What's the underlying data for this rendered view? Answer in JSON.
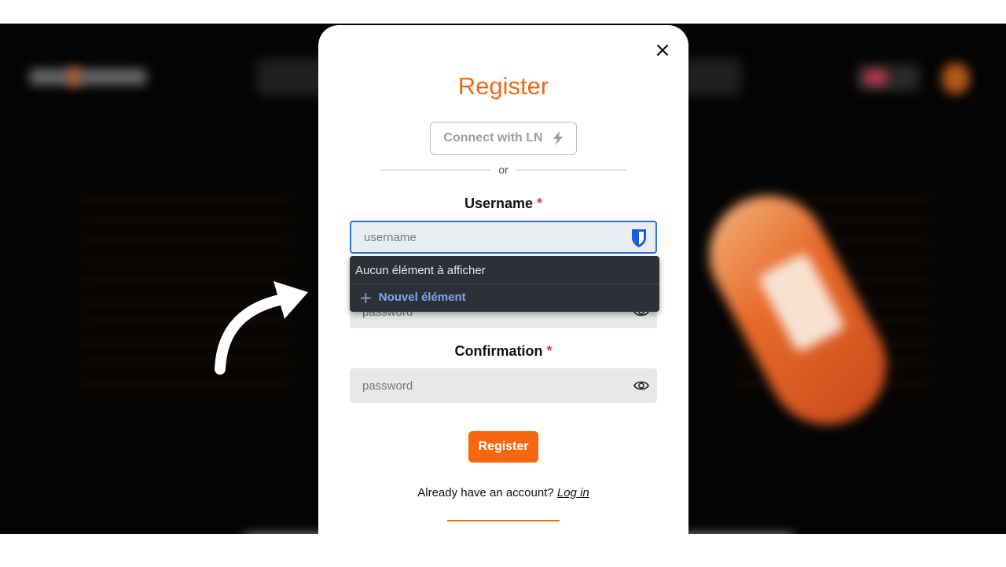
{
  "modal": {
    "close_glyph": "×",
    "title": "Register",
    "connect_ln_label": "Connect with LN",
    "connect_ln_icon": "lightning-icon",
    "or_text": "or",
    "username": {
      "label": "Username",
      "required_mark": "*",
      "placeholder": "username",
      "value": ""
    },
    "password": {
      "placeholder": "password"
    },
    "confirmation": {
      "label": "Confirmation",
      "required_mark": "*",
      "placeholder": "password"
    },
    "register_button": "Register",
    "footer_text": "Already have an account?",
    "login_link": "Log in"
  },
  "autofill_dropdown": {
    "empty_text": "Aucun élément à afficher",
    "new_item_plus": "+",
    "new_item_label": "Nouvel élément",
    "extension_icon": "bitwarden-shield-icon"
  },
  "colors": {
    "accent": "#f7670f",
    "title": "#ef6a13",
    "required": "#e53935",
    "focus_border": "#2f6fd6",
    "dropdown_bg": "#2e3038",
    "dropdown_link": "#79a8f2"
  }
}
